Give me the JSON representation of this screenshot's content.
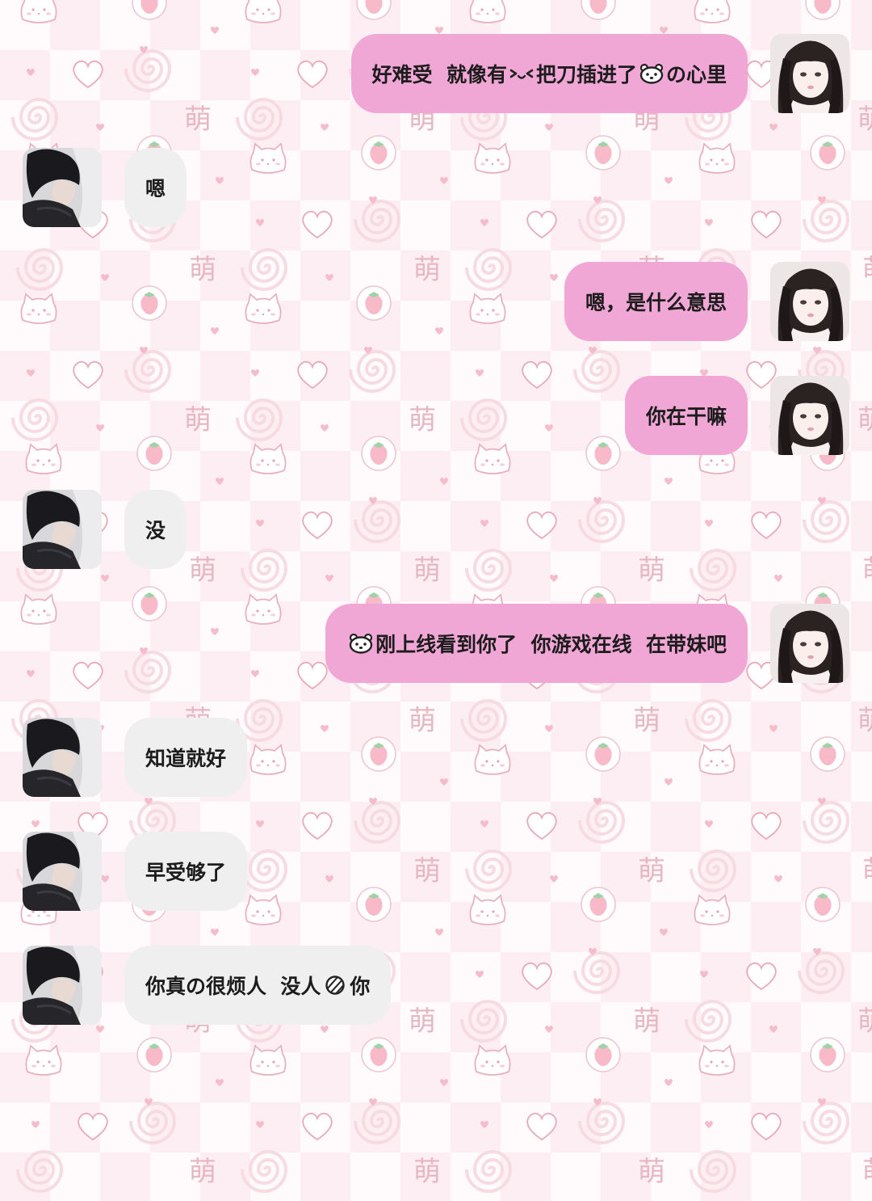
{
  "theme": {
    "sent_bubble_color": "#f1a7d5",
    "received_bubble_color": "#efefef",
    "text_color": "#1c1c1c",
    "wallpaper_motifs": [
      "cat-face-icon",
      "strawberry-icon",
      "heart-icon",
      "spiral-icon",
      "meng-character"
    ]
  },
  "wallpaper": {
    "meng_text": "萌"
  },
  "messages": [
    {
      "side": "right",
      "sender": "girl",
      "parts": [
        {
          "text": "好难受  就像有"
        },
        {
          "icon": "face-emoji-icon"
        },
        {
          "text": "把刀插进了"
        },
        {
          "icon": "bear-face-emoji-icon"
        },
        {
          "text": "の心里"
        }
      ]
    },
    {
      "side": "left",
      "sender": "boy",
      "parts": [
        {
          "text": "嗯"
        }
      ]
    },
    {
      "side": "right",
      "sender": "girl",
      "parts": [
        {
          "text": "嗯，是什么意思"
        }
      ]
    },
    {
      "side": "right",
      "sender": "girl",
      "parts": [
        {
          "text": "你在干嘛"
        }
      ]
    },
    {
      "side": "left",
      "sender": "boy",
      "parts": [
        {
          "text": "没"
        }
      ]
    },
    {
      "side": "right",
      "sender": "girl",
      "parts": [
        {
          "icon": "bear-face-emoji-icon"
        },
        {
          "text": "刚上线看到你了  你游戏在线  在带妹吧"
        }
      ]
    },
    {
      "side": "left",
      "sender": "boy",
      "parts": [
        {
          "text": "知道就好"
        }
      ]
    },
    {
      "side": "left",
      "sender": "boy",
      "parts": [
        {
          "text": "早受够了"
        }
      ]
    },
    {
      "side": "left",
      "sender": "boy",
      "parts": [
        {
          "text": "你真の很烦人  没人"
        },
        {
          "icon": "striped-heart-emoji-icon"
        },
        {
          "text": "你"
        }
      ]
    }
  ]
}
